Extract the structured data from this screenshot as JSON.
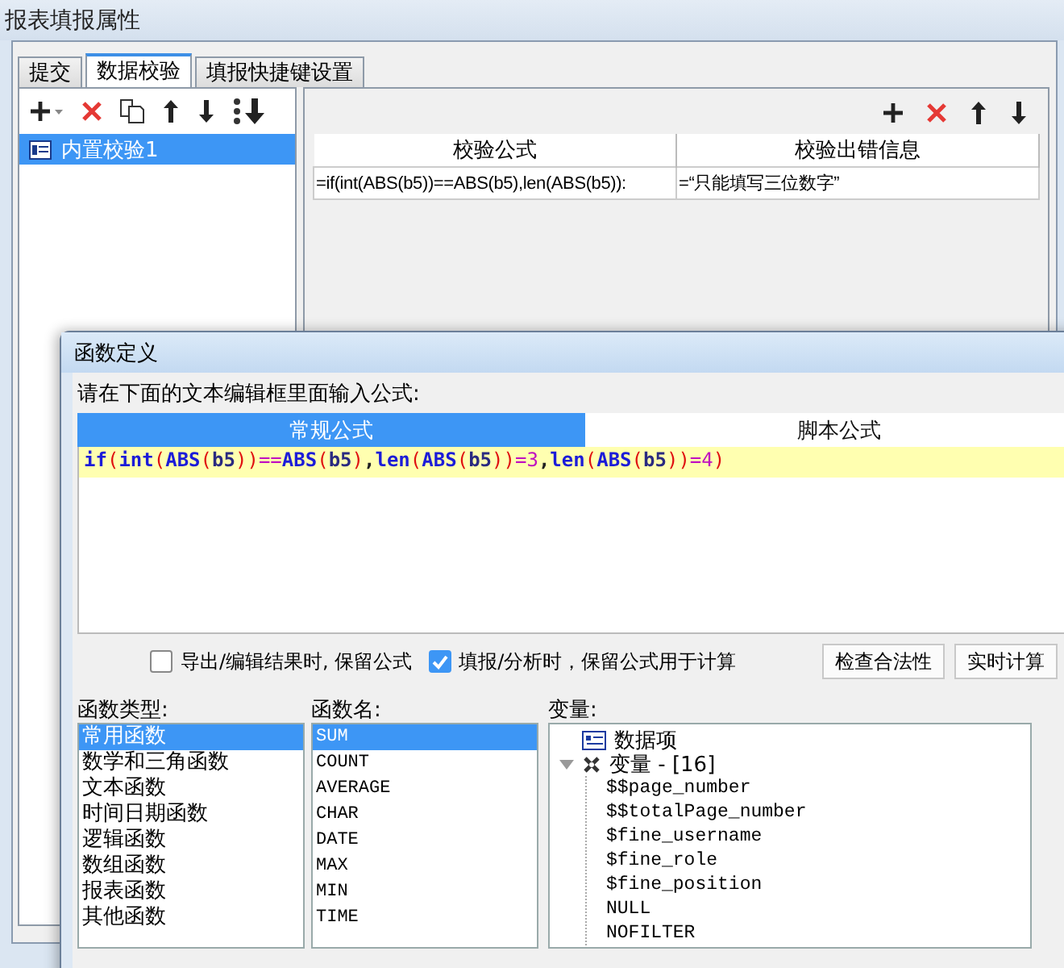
{
  "window": {
    "title": "报表填报属性"
  },
  "tabs": [
    {
      "label": "提交",
      "selected": false
    },
    {
      "label": "数据校验",
      "selected": true
    },
    {
      "label": "填报快捷键设置",
      "selected": false
    }
  ],
  "checks": [
    {
      "label": "内置校验1",
      "selected": true
    }
  ],
  "rules_table": {
    "columns": [
      "校验公式",
      "校验出错信息"
    ],
    "rows": [
      [
        "=if(int(ABS(b5))==ABS(b5),len(ABS(b5)):",
        "=“只能填写三位数字”"
      ]
    ]
  },
  "dialog": {
    "title": "函数定义",
    "prompt": "请在下面的文本编辑框里面输入公式:",
    "modes": [
      {
        "label": "常规公式",
        "selected": true
      },
      {
        "label": "脚本公式",
        "selected": false
      }
    ],
    "formula_tokens": [
      {
        "kind": "keyword",
        "text": "if"
      },
      {
        "kind": "paren",
        "text": "("
      },
      {
        "kind": "keyword",
        "text": "int"
      },
      {
        "kind": "paren",
        "text": "("
      },
      {
        "kind": "keyword",
        "text": "ABS"
      },
      {
        "kind": "paren",
        "text": "("
      },
      {
        "kind": "ident",
        "text": "b5"
      },
      {
        "kind": "paren",
        "text": "))"
      },
      {
        "kind": "op",
        "text": "=="
      },
      {
        "kind": "keyword",
        "text": "ABS"
      },
      {
        "kind": "paren",
        "text": "("
      },
      {
        "kind": "ident",
        "text": "b5"
      },
      {
        "kind": "paren",
        "text": ")"
      },
      {
        "kind": "punct",
        "text": ","
      },
      {
        "kind": "keyword",
        "text": "len"
      },
      {
        "kind": "paren",
        "text": "("
      },
      {
        "kind": "keyword",
        "text": "ABS"
      },
      {
        "kind": "paren",
        "text": "("
      },
      {
        "kind": "ident",
        "text": "b5"
      },
      {
        "kind": "paren",
        "text": "))"
      },
      {
        "kind": "op",
        "text": "=3"
      },
      {
        "kind": "punct",
        "text": ","
      },
      {
        "kind": "keyword",
        "text": "len"
      },
      {
        "kind": "paren",
        "text": "("
      },
      {
        "kind": "keyword",
        "text": "ABS"
      },
      {
        "kind": "paren",
        "text": "("
      },
      {
        "kind": "ident",
        "text": "b5"
      },
      {
        "kind": "paren",
        "text": "))"
      },
      {
        "kind": "op",
        "text": "=4"
      },
      {
        "kind": "paren",
        "text": ")"
      }
    ],
    "options": [
      {
        "label": "导出/编辑结果时, 保留公式",
        "checked": false
      },
      {
        "label": "填报/分析时，保留公式用于计算",
        "checked": true
      }
    ],
    "buttons": [
      "检查合法性",
      "实时计算"
    ],
    "function_types": {
      "label": "函数类型:",
      "items": [
        {
          "label": "常用函数",
          "selected": true
        },
        {
          "label": "数学和三角函数",
          "selected": false
        },
        {
          "label": "文本函数",
          "selected": false
        },
        {
          "label": "时间日期函数",
          "selected": false
        },
        {
          "label": "逻辑函数",
          "selected": false
        },
        {
          "label": "数组函数",
          "selected": false
        },
        {
          "label": "报表函数",
          "selected": false
        },
        {
          "label": "其他函数",
          "selected": false
        }
      ]
    },
    "function_names": {
      "label": "函数名:",
      "items": [
        {
          "label": "SUM",
          "selected": true
        },
        {
          "label": "COUNT",
          "selected": false
        },
        {
          "label": "AVERAGE",
          "selected": false
        },
        {
          "label": "CHAR",
          "selected": false
        },
        {
          "label": "DATE",
          "selected": false
        },
        {
          "label": "MAX",
          "selected": false
        },
        {
          "label": "MIN",
          "selected": false
        },
        {
          "label": "TIME",
          "selected": false
        }
      ]
    },
    "variables": {
      "label": "变量:",
      "tree": [
        {
          "kind": "dataset",
          "label": "数据项"
        },
        {
          "kind": "group",
          "label": "变量 - [16]",
          "expanded": true,
          "children": [
            {
              "label": "$$page_number"
            },
            {
              "label": "$$totalPage_number"
            },
            {
              "label": "$fine_username"
            },
            {
              "label": "$fine_role"
            },
            {
              "label": "$fine_position"
            },
            {
              "label": "NULL"
            },
            {
              "label": "NOFILTER"
            }
          ]
        }
      ]
    }
  }
}
